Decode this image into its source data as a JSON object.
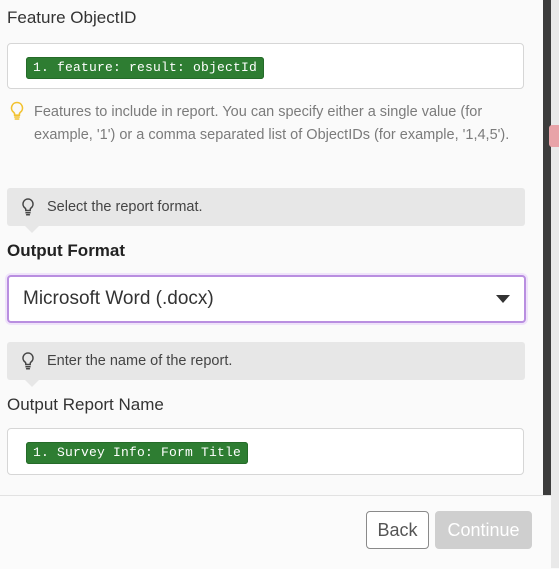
{
  "fields": {
    "feature_objectid": {
      "label": "Feature ObjectID",
      "token": "1. feature: result: objectId",
      "help": "Features to include in report. You can specify either a single value (for example, '1') or a comma separated list of ObjectIDs (for example, '1,4,5')."
    },
    "output_format": {
      "hint": "Select the report format.",
      "label": "Output Format",
      "selected": "Microsoft Word (.docx)"
    },
    "output_report_name": {
      "hint": "Enter the name of the report.",
      "label": "Output Report Name",
      "token": "1. Survey Info: Form Title"
    }
  },
  "footer": {
    "back_label": "Back",
    "continue_label": "Continue"
  },
  "icons": {
    "help": "lightbulb-icon",
    "hint": "lightbulb-outline-icon",
    "dropdown": "chevron-down-icon"
  },
  "colors": {
    "token_bg": "#2e7d32",
    "select_border": "#b98ee0",
    "help_bulb": "#f2c230"
  }
}
